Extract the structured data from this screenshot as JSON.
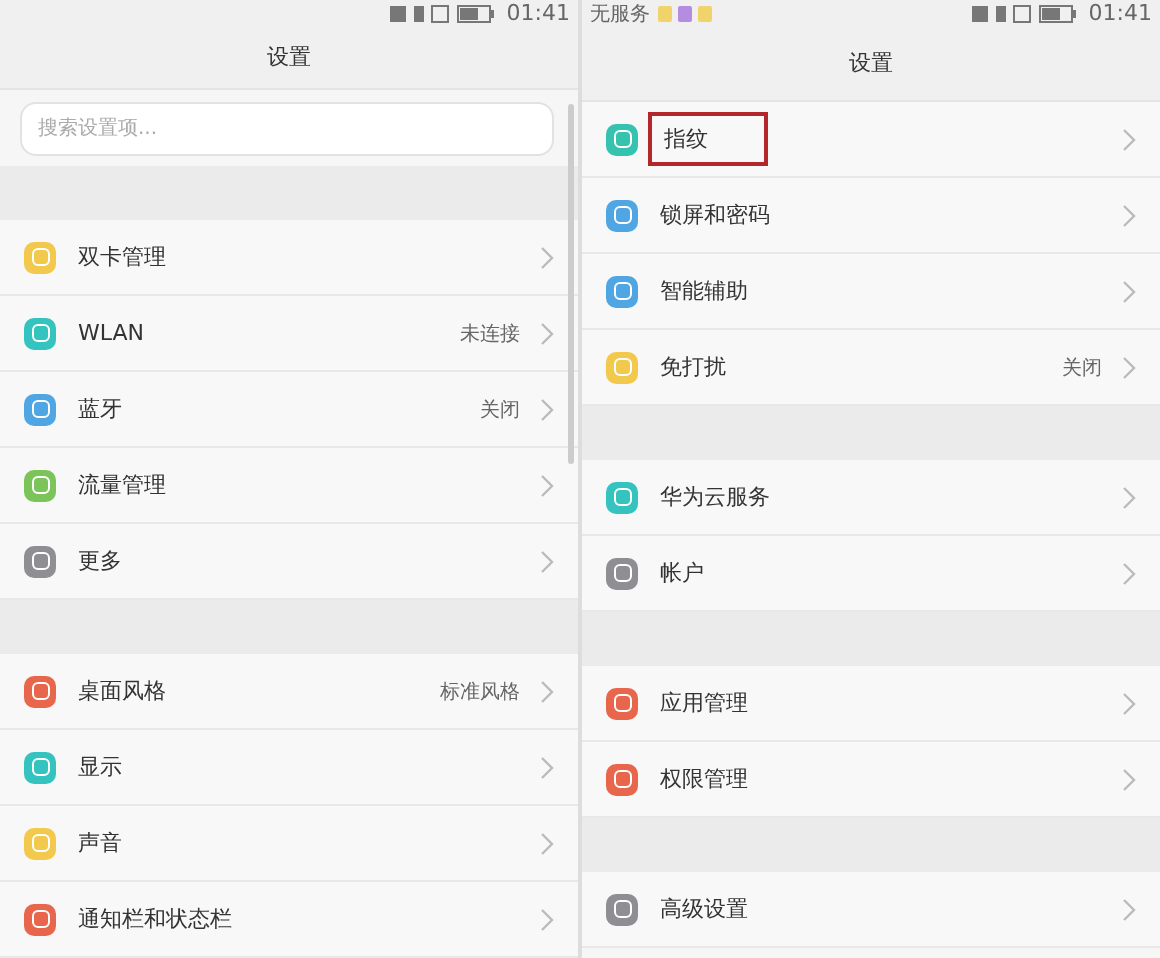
{
  "screens": [
    {
      "status_bar": {
        "time": "01:41"
      },
      "title": "设置",
      "search": {
        "placeholder": "搜索设置项..."
      },
      "scrollbar": true,
      "groups": [
        [
          {
            "label": "双卡管理",
            "color": "#f3c94d",
            "highlighted": false
          },
          {
            "label": "WLAN",
            "value": "未连接",
            "color": "#35c3c0",
            "highlighted": false
          },
          {
            "label": "蓝牙",
            "value": "关闭",
            "color": "#4fa6e3",
            "highlighted": false
          },
          {
            "label": "流量管理",
            "color": "#7cc35a",
            "highlighted": false
          },
          {
            "label": "更多",
            "color": "#8e8e93",
            "highlighted": false
          }
        ],
        [
          {
            "label": "桌面风格",
            "value": "标准风格",
            "color": "#e8674c",
            "highlighted": false
          },
          {
            "label": "显示",
            "color": "#35c3c0",
            "highlighted": false
          },
          {
            "label": "声音",
            "color": "#f3c94d",
            "highlighted": false
          },
          {
            "label": "通知栏和状态栏",
            "color": "#e8674c",
            "highlighted": false
          }
        ]
      ]
    },
    {
      "status_bar": {
        "carrier": "无服务",
        "time": "01:41"
      },
      "title": "设置",
      "scrollbar": false,
      "groups": [
        [
          {
            "label": "指纹",
            "color": "#35c3b0",
            "highlighted": true
          },
          {
            "label": "锁屏和密码",
            "color": "#4fa6e3",
            "highlighted": false
          },
          {
            "label": "智能辅助",
            "color": "#4fa6e3",
            "highlighted": false
          },
          {
            "label": "免打扰",
            "value": "关闭",
            "color": "#f3c94d",
            "highlighted": false
          }
        ],
        [
          {
            "label": "华为云服务",
            "color": "#35c3c0",
            "highlighted": false
          },
          {
            "label": "帐户",
            "color": "#8e8e93",
            "highlighted": false
          }
        ],
        [
          {
            "label": "应用管理",
            "color": "#e8674c",
            "highlighted": false
          },
          {
            "label": "权限管理",
            "color": "#e8674c",
            "highlighted": false
          }
        ],
        [
          {
            "label": "高级设置",
            "color": "#8e8e93",
            "highlighted": false
          }
        ]
      ]
    }
  ]
}
